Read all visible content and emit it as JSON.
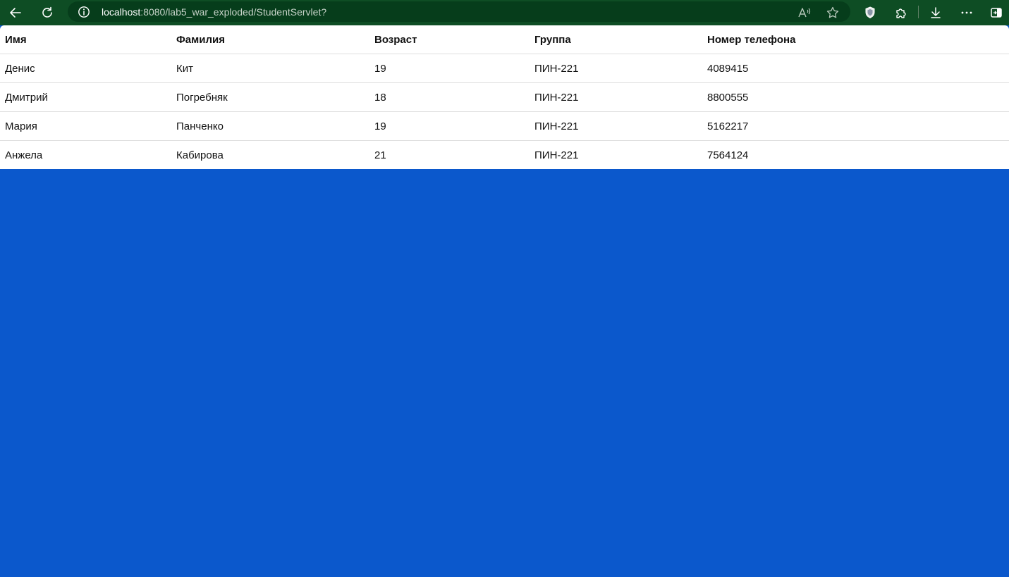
{
  "browser": {
    "url_host": "localhost",
    "url_path": ":8080/lab5_war_exploded/StudentServlet?",
    "icons": {
      "back": "back-arrow-icon",
      "refresh": "refresh-icon",
      "site_info": "info-icon",
      "read_aloud": "read-aloud-icon",
      "favorite": "star-icon",
      "shield": "shield-icon",
      "extensions": "puzzle-icon",
      "downloads": "download-icon",
      "menu": "more-icon",
      "sidebar": "sidebar-icon"
    },
    "colors": {
      "toolbar": "#0e4d24",
      "address_bar": "#063d1b",
      "page_background": "#0b58cc"
    }
  },
  "table": {
    "headers": [
      "Имя",
      "Фамилия",
      "Возраст",
      "Группа",
      "Номер телефона"
    ],
    "rows": [
      [
        "Денис",
        "Кит",
        "19",
        "ПИН-221",
        "4089415"
      ],
      [
        "Дмитрий",
        "Погребняк",
        "18",
        "ПИН-221",
        "8800555"
      ],
      [
        "Мария",
        "Панченко",
        "19",
        "ПИН-221",
        "5162217"
      ],
      [
        "Анжела",
        "Кабирова",
        "21",
        "ПИН-221",
        "7564124"
      ]
    ]
  }
}
